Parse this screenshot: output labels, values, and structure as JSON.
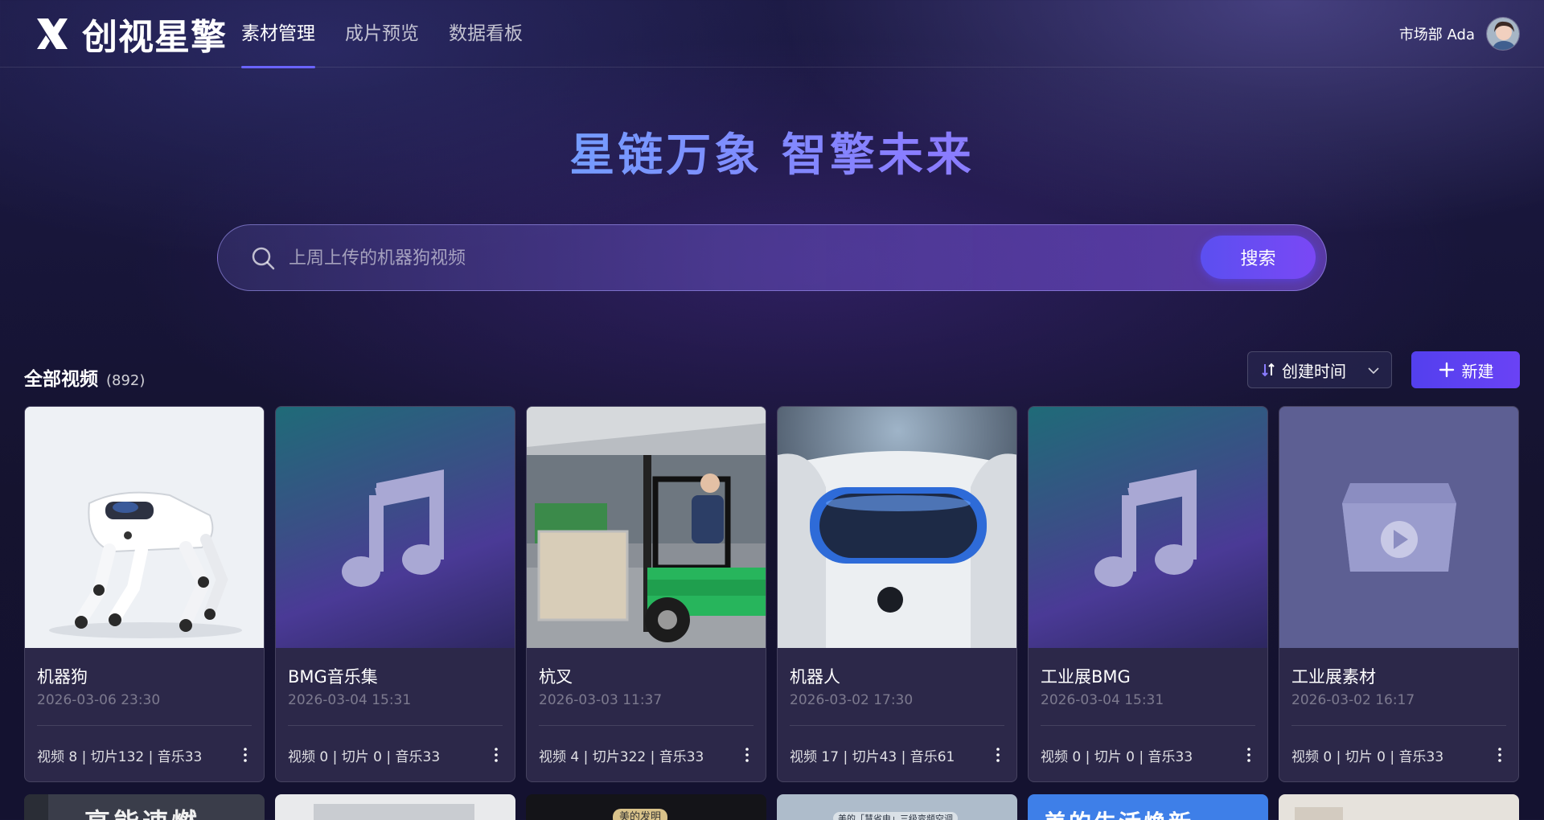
{
  "app": {
    "name": "创视星擎"
  },
  "nav": {
    "items": [
      {
        "label": "素材管理",
        "active": true
      },
      {
        "label": "成片预览",
        "active": false
      },
      {
        "label": "数据看板",
        "active": false
      }
    ]
  },
  "user": {
    "name": "市场部 Ada"
  },
  "hero": {
    "slogan": "星链万象  智擎未来"
  },
  "search": {
    "placeholder": "上周上传的机器狗视频",
    "value": "",
    "button_label": "搜索"
  },
  "section": {
    "title": "全部视频",
    "count": "(892)"
  },
  "toolbar": {
    "sort_label": "创建时间",
    "new_label": "新建"
  },
  "colors": {
    "accent": "#5b4ff0",
    "nav_active_bar": "#6a64ff"
  },
  "cards": [
    {
      "title": "机器狗",
      "date": "2026-03-06 23:30",
      "stats": "视频 8 | 切片132 | 音乐33",
      "thumb": "robot-dog-photo"
    },
    {
      "title": "BMG音乐集",
      "date": "2026-03-04 15:31",
      "stats": "视频 0 | 切片 0 | 音乐33",
      "thumb": "music-note-icon"
    },
    {
      "title": "杭叉",
      "date": "2026-03-03 11:37",
      "stats": "视频 4 | 切片322 | 音乐33",
      "thumb": "forklift-photo"
    },
    {
      "title": "机器人",
      "date": "2026-03-02 17:30",
      "stats": "视频 17 | 切片43 | 音乐61",
      "thumb": "robot-head-photo"
    },
    {
      "title": "工业展BMG",
      "date": "2026-03-04 15:31",
      "stats": "视频 0 | 切片 0 | 音乐33",
      "thumb": "music-note-icon"
    },
    {
      "title": "工业展素材",
      "date": "2026-03-02 16:17",
      "stats": "视频 0 | 切片 0 | 音乐33",
      "thumb": "empty-folder-icon"
    }
  ],
  "row2_partial_titles": [
    "高能速燃",
    "",
    "美的发明",
    "美的「慧省电」三级变频空调",
    "美的生活焕新",
    ""
  ]
}
